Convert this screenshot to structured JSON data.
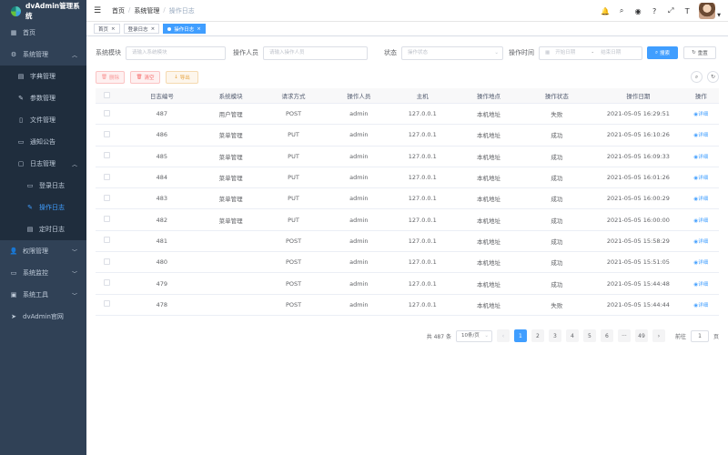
{
  "app": {
    "title": "dvAdmin管理系统"
  },
  "sidebar": {
    "items": [
      {
        "label": "首页",
        "icon": "dashboard-icon"
      },
      {
        "label": "系统管理",
        "icon": "gear-icon",
        "expanded": true
      },
      {
        "label": "字典管理",
        "icon": "book-icon"
      },
      {
        "label": "参数管理",
        "icon": "edit-icon"
      },
      {
        "label": "文件管理",
        "icon": "file-icon"
      },
      {
        "label": "通知公告",
        "icon": "message-icon"
      },
      {
        "label": "日志管理",
        "icon": "log-icon",
        "expanded": true
      },
      {
        "label": "登录日志",
        "icon": "monitor-icon"
      },
      {
        "label": "操作日志",
        "icon": "form-icon",
        "active": true
      },
      {
        "label": "定时日志",
        "icon": "job-icon"
      },
      {
        "label": "权限管理",
        "icon": "user-icon"
      },
      {
        "label": "系统监控",
        "icon": "monitor-icon"
      },
      {
        "label": "系统工具",
        "icon": "tool-icon"
      },
      {
        "label": "dvAdmin官网",
        "icon": "send-icon"
      }
    ]
  },
  "header": {
    "breadcrumb": [
      "首页",
      "系统管理",
      "操作日志"
    ]
  },
  "tags": [
    {
      "label": "首页"
    },
    {
      "label": "登录日志"
    },
    {
      "label": "操作日志",
      "active": true
    }
  ],
  "filters": {
    "module_label": "系统模块",
    "module_placeholder": "请输入系统模块",
    "operator_label": "操作人员",
    "operator_placeholder": "请输入操作人员",
    "status_label": "状态",
    "status_placeholder": "操作状态",
    "time_label": "操作时间",
    "start_placeholder": "开始日期",
    "range_sep": "-",
    "end_placeholder": "结束日期",
    "search_label": "搜索",
    "reset_label": "重置"
  },
  "toolbar": {
    "delete_label": "删除",
    "clear_label": "清空",
    "export_label": "导出"
  },
  "table": {
    "columns": [
      "日志编号",
      "系统模块",
      "请求方式",
      "操作人员",
      "主机",
      "操作地点",
      "操作状态",
      "操作日期",
      "操作"
    ],
    "action_label": "详细",
    "rows": [
      {
        "id": "487",
        "module": "用户管理",
        "method": "POST",
        "user": "admin",
        "host": "127.0.0.1",
        "location": "本机地址",
        "status": "失败",
        "date": "2021-05-05 16:29:51"
      },
      {
        "id": "486",
        "module": "菜单管理",
        "method": "PUT",
        "user": "admin",
        "host": "127.0.0.1",
        "location": "本机地址",
        "status": "成功",
        "date": "2021-05-05 16:10:26"
      },
      {
        "id": "485",
        "module": "菜单管理",
        "method": "PUT",
        "user": "admin",
        "host": "127.0.0.1",
        "location": "本机地址",
        "status": "成功",
        "date": "2021-05-05 16:09:33"
      },
      {
        "id": "484",
        "module": "菜单管理",
        "method": "PUT",
        "user": "admin",
        "host": "127.0.0.1",
        "location": "本机地址",
        "status": "成功",
        "date": "2021-05-05 16:01:26"
      },
      {
        "id": "483",
        "module": "菜单管理",
        "method": "PUT",
        "user": "admin",
        "host": "127.0.0.1",
        "location": "本机地址",
        "status": "成功",
        "date": "2021-05-05 16:00:29"
      },
      {
        "id": "482",
        "module": "菜单管理",
        "method": "PUT",
        "user": "admin",
        "host": "127.0.0.1",
        "location": "本机地址",
        "status": "成功",
        "date": "2021-05-05 16:00:00"
      },
      {
        "id": "481",
        "module": "",
        "method": "POST",
        "user": "admin",
        "host": "127.0.0.1",
        "location": "本机地址",
        "status": "成功",
        "date": "2021-05-05 15:58:29"
      },
      {
        "id": "480",
        "module": "",
        "method": "POST",
        "user": "admin",
        "host": "127.0.0.1",
        "location": "本机地址",
        "status": "成功",
        "date": "2021-05-05 15:51:05"
      },
      {
        "id": "479",
        "module": "",
        "method": "POST",
        "user": "admin",
        "host": "127.0.0.1",
        "location": "本机地址",
        "status": "成功",
        "date": "2021-05-05 15:44:48"
      },
      {
        "id": "478",
        "module": "",
        "method": "POST",
        "user": "admin",
        "host": "127.0.0.1",
        "location": "本机地址",
        "status": "失败",
        "date": "2021-05-05 15:44:44"
      }
    ]
  },
  "pagination": {
    "total_text": "共 487 条",
    "page_size": "10条/页",
    "pages": [
      "1",
      "2",
      "3",
      "4",
      "5",
      "6",
      "···",
      "49"
    ],
    "current": "1",
    "goto_label": "前往",
    "goto_value": "1",
    "page_suffix": "页"
  },
  "colors": {
    "sidebar_bg": "#304156",
    "primary": "#409eff",
    "danger": "#f56c6c",
    "warning": "#e6a23c"
  }
}
